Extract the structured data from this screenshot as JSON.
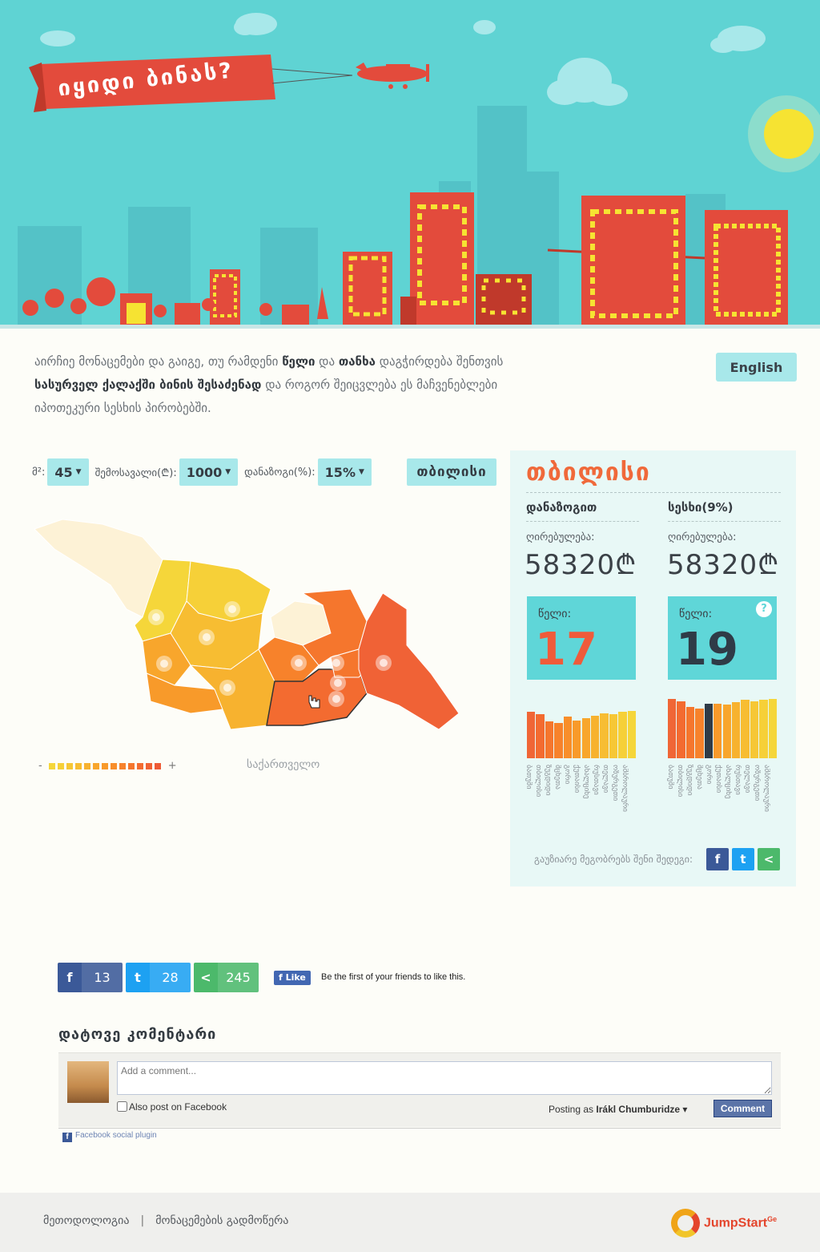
{
  "hero": {
    "title": "იყიდი ბინას?"
  },
  "intro": {
    "part1": "აირჩიე მონაცემები და გაიგე, თუ რამდენი ",
    "bold1": "წელი",
    "part2": " და ",
    "bold2": "თანხა",
    "part3": " დაგჭირდება შენთვის ",
    "bold3": "სასურველ ქალაქში ბინის შესაძენად",
    "part4": " და როგორ შეიცვლება ეს მაჩვენებლები იპოთეკური სესხის პირობებში."
  },
  "lang_button": "English",
  "controls": {
    "area_label": "მ²:",
    "area_value": "45",
    "income_label": "შემოსავალი(₾):",
    "income_value": "1000",
    "savings_label": "დანაზოგი(%):",
    "savings_value": "15%",
    "city_button": "თბილისი"
  },
  "map": {
    "country_label": "საქართველო",
    "legend_minus": "-",
    "legend_plus": "+",
    "legend_colors": [
      "#f5d63a",
      "#f6d038",
      "#f6c735",
      "#f7bd32",
      "#f7b22f",
      "#f8a62c",
      "#f89a2a",
      "#f88e2a",
      "#f7822b",
      "#f5762d",
      "#f36b30",
      "#f06233",
      "#ee5a35"
    ]
  },
  "panel": {
    "city": "თბილისი",
    "savings_col": {
      "title": "დანაზოგით",
      "value_label": "ღირებულება:",
      "value": "58320₾",
      "years_label": "წელი:",
      "years": "17",
      "years_color": "#f05b3a"
    },
    "loan_col": {
      "title": "სესხი(9%)",
      "value_label": "ღირებულება:",
      "value": "58320₾",
      "years_label": "წელი:",
      "years": "19",
      "years_color": "#2f3b47",
      "help": "?"
    },
    "bar_cities": [
      "ბათუმი",
      "თბილისი",
      "ზუგდიდი",
      "მცხეთა",
      "გორი",
      "ქუთაისი",
      "ახალციხე",
      "რუსთავი",
      "თელავი",
      "ოზურგეთი",
      "ამბროლაური"
    ],
    "bars_left": [
      0.78,
      0.74,
      0.62,
      0.6,
      0.7,
      0.64,
      0.68,
      0.72,
      0.76,
      0.74,
      0.78,
      0.8
    ],
    "bars_left_colors": [
      "#f06636",
      "#f36b30",
      "#f5762d",
      "#f7822b",
      "#f88e2a",
      "#f89a2a",
      "#f8a62c",
      "#f7b22f",
      "#f7bd32",
      "#f6c735",
      "#f6d038",
      "#f5d63a"
    ],
    "bars_right": [
      1.0,
      0.96,
      0.86,
      0.84,
      0.92,
      0.92,
      0.9,
      0.94,
      0.98,
      0.96,
      0.98,
      1.0
    ],
    "bars_right_colors": [
      "#f06636",
      "#f36b30",
      "#f5762d",
      "#f7822b",
      "#2f3b47",
      "#f89a2a",
      "#f8a62c",
      "#f7b22f",
      "#f7bd32",
      "#f6c735",
      "#f6d038",
      "#f5d63a"
    ],
    "share_text": "გაუზიარე მეგობრებს შენი შედეგი:"
  },
  "social": {
    "facebook_count": "13",
    "twitter_count": "28",
    "share_count": "245",
    "like_button": "Like",
    "like_text": "Be the first of your friends to like this."
  },
  "comments": {
    "title": "დატოვე კომენტარი",
    "placeholder": "Add a comment...",
    "also_post": "Also post on Facebook",
    "posting_as_label": "Posting as",
    "user_name": "Irákl Chumburidze",
    "comment_button": "Comment",
    "plugin_label": "Facebook social plugin"
  },
  "footer": {
    "link_methodology": "მეთოდოლოგია",
    "link_download": "მონაცემების გადმოწერა",
    "logo_name": "JumpStart",
    "logo_sup": "Ge"
  },
  "colors": {
    "accent": "#5fd6d8",
    "orange": "#f0693a",
    "facebook": "#3b5998",
    "twitter": "#1da1f2",
    "share": "#4cb96b"
  }
}
